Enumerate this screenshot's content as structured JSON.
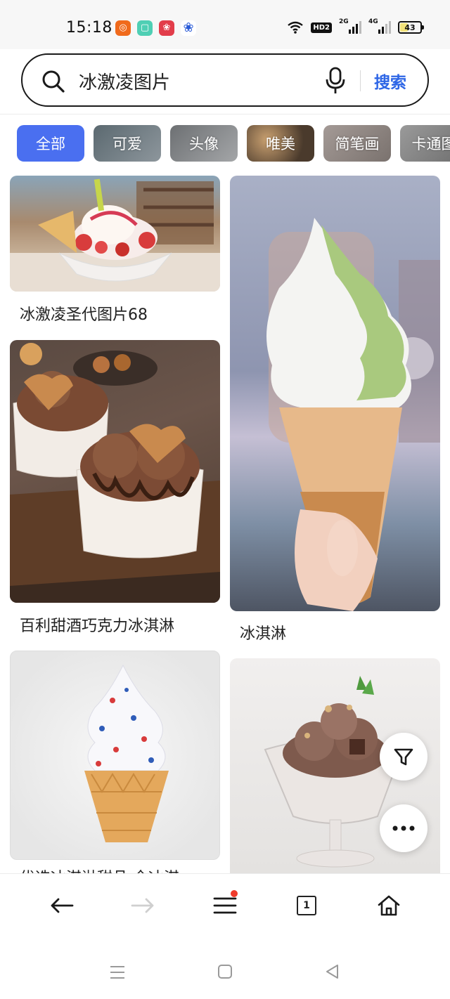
{
  "status_bar": {
    "time": "15:18",
    "network_1": "2G",
    "network_2": "4G",
    "hd_badge": "HD2",
    "battery": "43",
    "battery_level": 0.43
  },
  "search": {
    "query": "冰激凌图片",
    "button_label": "搜索"
  },
  "chips": [
    {
      "label": "全部",
      "active": true,
      "color": "#4a6ff0"
    },
    {
      "label": "可爱",
      "active": false,
      "color": "#6f7b83"
    },
    {
      "label": "头像",
      "active": false,
      "color": "#8c8f92"
    },
    {
      "label": "唯美",
      "active": false,
      "color": "#5b4a3a"
    },
    {
      "label": "简笔画",
      "active": false,
      "color": "#9a8f8a"
    },
    {
      "label": "卡通图",
      "active": false,
      "color": "#8a8a8a"
    }
  ],
  "results": [
    {
      "caption": "冰激凌圣代图片68"
    },
    {
      "caption": "百利甜酒巧克力冰淇淋"
    },
    {
      "caption": "冰淇淋"
    },
    {
      "caption": "优选冰淇淋甜品 全冰淇"
    }
  ],
  "colors": {
    "accent": "#2e66e6",
    "notification_dot": "#ef3b2c"
  },
  "bottom_nav": {
    "tab_count": "1"
  }
}
